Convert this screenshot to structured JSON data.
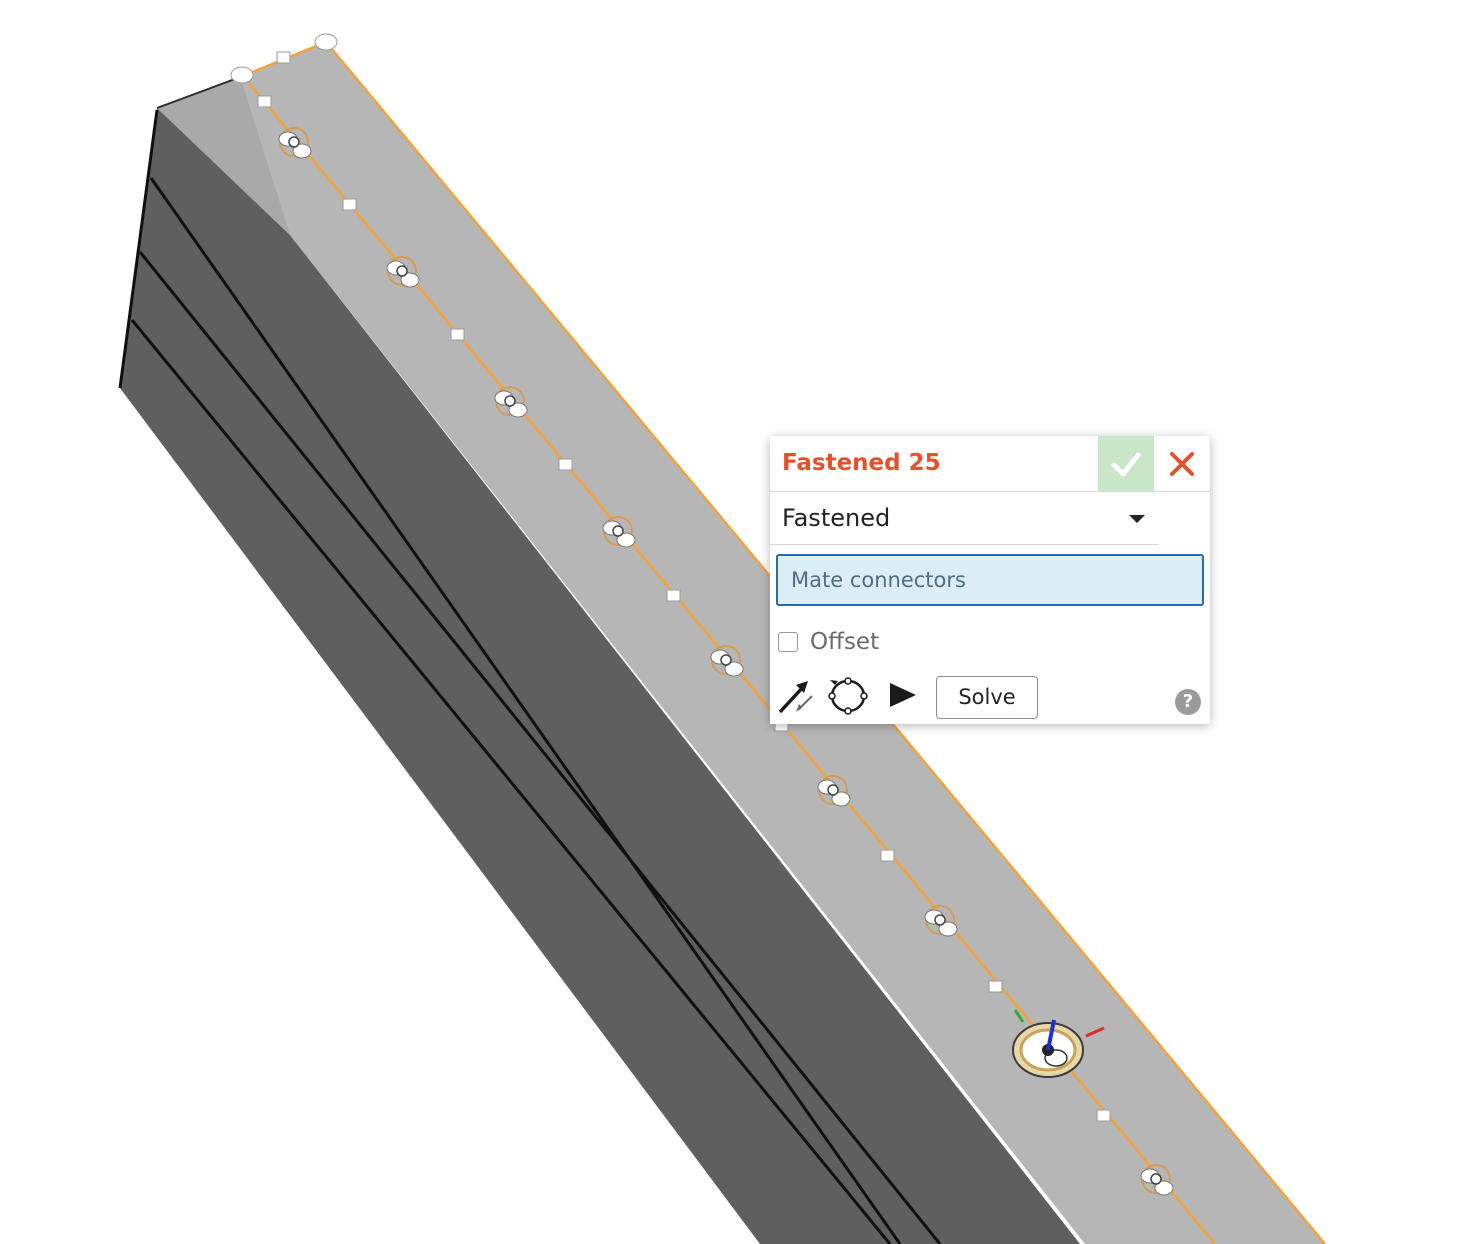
{
  "dialog": {
    "title": "Fastened 25",
    "accept_icon": "check-icon",
    "cancel_icon": "close-icon",
    "mate_type": "Fastened",
    "mate_connectors_label": "Mate connectors",
    "offset_label": "Offset",
    "offset_checked": false,
    "solve_label": "Solve",
    "help_glyph": "?",
    "tools": [
      "flip-primary-axis-icon",
      "reorient-secondary-axis-icon",
      "animate-icon"
    ]
  },
  "colors": {
    "title": "#e0532b",
    "accept_bg": "#c9e7c8",
    "cancel": "#e0532b",
    "field_bg": "#dbeef8",
    "field_border": "#2c6aa6",
    "edge_highlight": "#f2a33a",
    "top_face": "#b6b6b6",
    "side_face": "#5f5f5f"
  }
}
